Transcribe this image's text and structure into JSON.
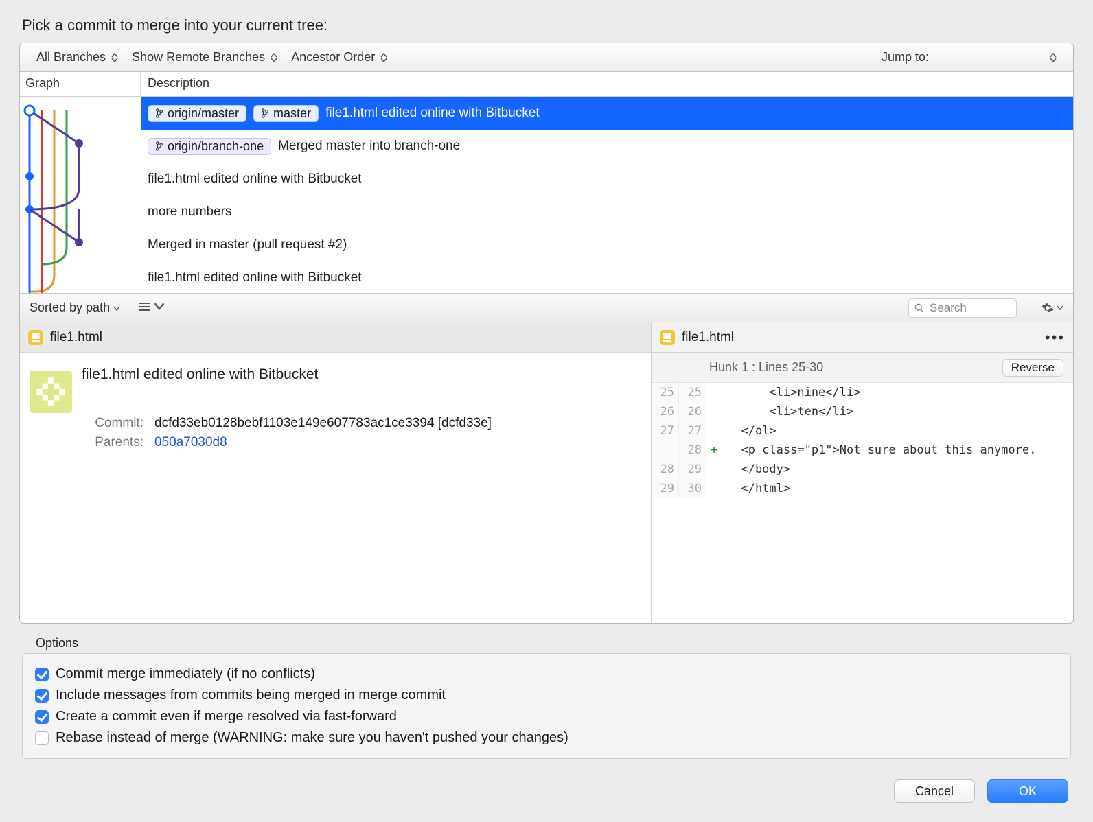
{
  "heading": "Pick a commit to merge into your current tree:",
  "toolbar1": {
    "branches": "All Branches",
    "show_remote": "Show Remote Branches",
    "order": "Ancestor Order",
    "jump_to": "Jump to:"
  },
  "columns": {
    "graph": "Graph",
    "description": "Description"
  },
  "commits": [
    {
      "tags": [
        {
          "label": "origin/master",
          "style": "blue"
        },
        {
          "label": "master",
          "style": "blue"
        }
      ],
      "message": "file1.html edited online with Bitbucket",
      "selected": true
    },
    {
      "tags": [
        {
          "label": "origin/branch-one",
          "style": "purple"
        }
      ],
      "message": "Merged master into branch-one",
      "selected": false
    },
    {
      "tags": [],
      "message": "file1.html edited online with Bitbucket",
      "selected": false
    },
    {
      "tags": [],
      "message": "more numbers",
      "selected": false
    },
    {
      "tags": [],
      "message": "Merged in master (pull request #2)",
      "selected": false
    },
    {
      "tags": [],
      "message": "file1.html edited online with Bitbucket",
      "selected": false
    }
  ],
  "toolbar2": {
    "sort": "Sorted by path",
    "search_placeholder": "Search"
  },
  "left": {
    "file_name": "file1.html",
    "commit_message": "file1.html edited online with Bitbucket",
    "commit_label": "Commit:",
    "commit_hash": "dcfd33eb0128bebf1103e149e607783ac1ce3394 [dcfd33e]",
    "parents_label": "Parents:",
    "parents_link": "050a7030d8"
  },
  "right": {
    "file_name": "file1.html",
    "hunk_label": "Hunk 1 : Lines 25-30",
    "reverse_label": "Reverse",
    "lines": [
      {
        "old": "25",
        "new": "25",
        "sign": " ",
        "text": "      <li>nine</li>"
      },
      {
        "old": "26",
        "new": "26",
        "sign": " ",
        "text": "      <li>ten</li>"
      },
      {
        "old": "27",
        "new": "27",
        "sign": " ",
        "text": "  </ol>"
      },
      {
        "old": "",
        "new": "28",
        "sign": "+",
        "text": "  <p class=\"p1\">Not sure about this anymore.",
        "added": true
      },
      {
        "old": "28",
        "new": "29",
        "sign": " ",
        "text": "  </body>"
      },
      {
        "old": "29",
        "new": "30",
        "sign": " ",
        "text": "  </html>"
      }
    ]
  },
  "options_heading": "Options",
  "options": [
    {
      "label": "Commit merge immediately (if no conflicts)",
      "checked": true
    },
    {
      "label": "Include messages from commits being merged in merge commit",
      "checked": true
    },
    {
      "label": "Create a commit even if merge resolved via fast-forward",
      "checked": true
    },
    {
      "label": "Rebase instead of merge (WARNING: make sure you haven't pushed your changes)",
      "checked": false
    }
  ],
  "buttons": {
    "cancel": "Cancel",
    "ok": "OK"
  }
}
